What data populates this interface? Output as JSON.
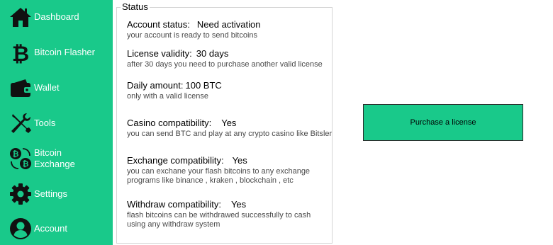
{
  "sidebar": {
    "items": [
      {
        "label": "Dashboard",
        "icon": "home-icon"
      },
      {
        "label": "Bitcoin Flasher",
        "icon": "bitcoin-icon"
      },
      {
        "label": "Wallet",
        "icon": "wallet-icon"
      },
      {
        "label": "Tools",
        "icon": "tools-icon"
      },
      {
        "label": "Bitcoin Exchange",
        "icon": "exchange-icon"
      },
      {
        "label": "Settings",
        "icon": "gear-icon"
      },
      {
        "label": "Account",
        "icon": "user-icon"
      }
    ]
  },
  "status": {
    "title": "Status",
    "fields": [
      {
        "label": "Account status:",
        "value": "Need activation",
        "desc": "your account is ready to send bitcoins"
      },
      {
        "label": "License validity:",
        "value": "30 days",
        "desc": "after 30 days you need to purchase another valid license"
      },
      {
        "label": "Daily amount:",
        "value": "100 BTC",
        "desc": "only with a valid license"
      },
      {
        "label": "Casino compatibility:",
        "value": "Yes",
        "desc": "you can send BTC and play at any crypto casino like Bitsler"
      },
      {
        "label": "Exchange compatibility:",
        "value": "Yes",
        "desc": "you can exchane your flash bitcoins to any exchange programs like binance , kraken , blockchain , etc"
      },
      {
        "label": "Withdraw compatibility:",
        "value": "Yes",
        "desc": "flash bitcoins can be withdrawed successfully to cash using any withdraw system"
      }
    ]
  },
  "purchase_label": "Purchase a license",
  "colors": {
    "accent": "#19c98a",
    "icon": "#111111"
  }
}
